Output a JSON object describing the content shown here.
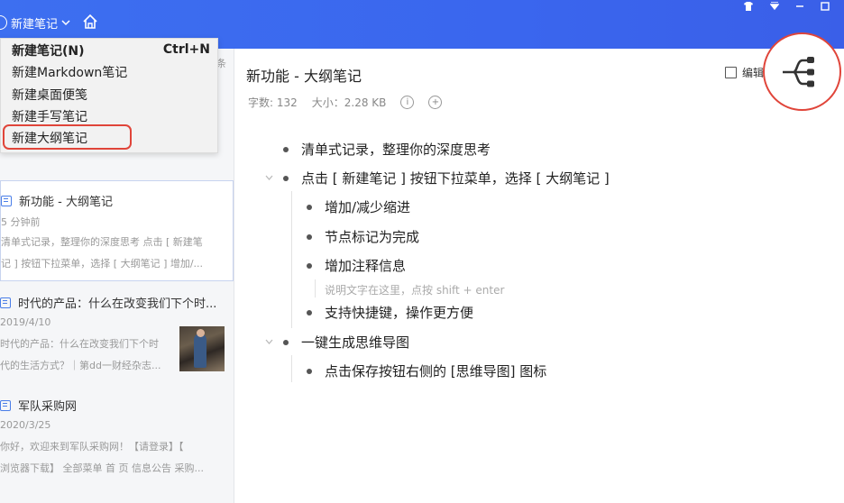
{
  "topbar": {
    "new_note_label": "新建笔记",
    "home_icon": "home-icon",
    "window_icons": [
      "shirt-icon",
      "dropdown-icon",
      "minimize-icon",
      "maximize-icon"
    ]
  },
  "dropdown": {
    "items": [
      {
        "label": "新建笔记(N)",
        "shortcut": "Ctrl+N"
      },
      {
        "label": "新建Markdown笔记"
      },
      {
        "label": "新建桌面便笺"
      },
      {
        "label": "新建手写笔记"
      },
      {
        "label": "新建大纲笔记"
      }
    ]
  },
  "list": {
    "count_suffix": "条",
    "notes": [
      {
        "title": "新功能 - 大纲笔记",
        "date": "5 分钟前",
        "snippet_1": "清单式记录，整理你的深度思考 点击 [ 新建笔",
        "snippet_2": "记 ] 按钮下拉菜单，选择 [ 大纲笔记 ] 增加/..."
      },
      {
        "title": "时代的产品：什么在改变我们下个时...",
        "date": "2019/4/10",
        "snippet_1": "时代的产品：什么在改变我们下个时",
        "snippet_2": "代的生活方式？｜第dd一财经杂志..."
      },
      {
        "title": "军队采购网",
        "date": "2020/3/25",
        "snippet_1": "你好，欢迎来到军队采购网！【请登录】【",
        "snippet_2": "浏览器下载】 全部菜单 首 页 信息公告 采购..."
      }
    ]
  },
  "editor": {
    "title": "新功能 - 大纲笔记",
    "word_count": "字数: 132",
    "size": "大小：2.28 KB",
    "edit_label": "编辑",
    "outline": [
      {
        "text": "清单式记录，整理你的深度思考"
      },
      {
        "text": "点击 [ 新建笔记 ] 按钮下拉菜单，选择 [ 大纲笔记 ]"
      },
      {
        "text": "增加/减少缩进"
      },
      {
        "text": "节点标记为完成"
      },
      {
        "text": "增加注释信息"
      },
      {
        "note": "说明文字在这里，点按 shift + enter"
      },
      {
        "text": "支持快捷键，操作更方便"
      },
      {
        "text": "一键生成思维导图"
      },
      {
        "text": "点击保存按钮右侧的 [思维导图] 图标"
      }
    ]
  },
  "colors": {
    "topbar": "#3b68ee",
    "highlight_red": "#e0453a",
    "accent_blue": "#4a7ee8"
  }
}
